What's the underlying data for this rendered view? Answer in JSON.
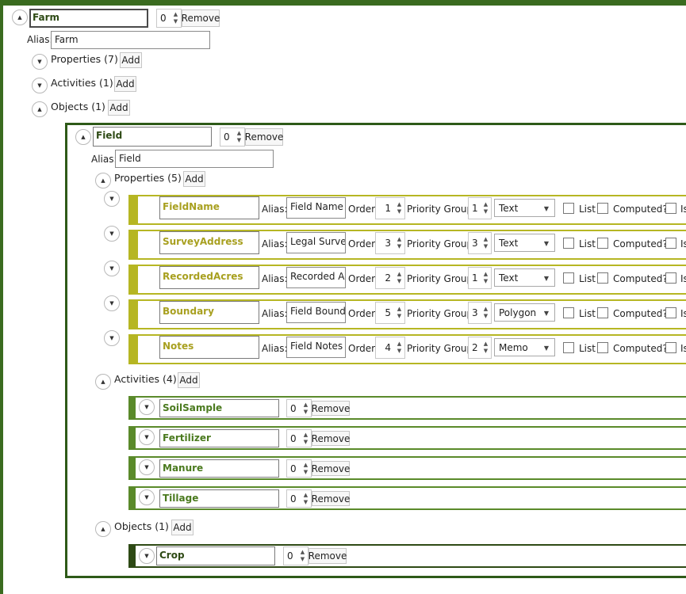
{
  "farm": {
    "name": "Farm",
    "order": "0",
    "remove_label": "Remove",
    "alias_label": "Alias:",
    "alias": "Farm",
    "sections": {
      "properties": "Properties (7)",
      "activities": "Activities (1)",
      "objects": "Objects (1)"
    },
    "add_label": "Add"
  },
  "field": {
    "name": "Field",
    "order": "0",
    "remove_label": "Remove",
    "alias_label": "Alias:",
    "alias": "Field",
    "properties_label": "Properties (5)",
    "activities_label": "Activities (4)",
    "objects_label": "Objects (1)",
    "add_label": "Add",
    "property_labels": {
      "alias": "Alias:",
      "order": "Order:",
      "priority_group": "Priority Group:",
      "list": "List",
      "computed": "Computed?",
      "is_truncated": "Is"
    },
    "properties": [
      {
        "name": "FieldName",
        "alias": "Field Name",
        "order": "1",
        "priority_group": "1",
        "type": "Text"
      },
      {
        "name": "SurveyAddress",
        "alias": "Legal Survey",
        "order": "3",
        "priority_group": "3",
        "type": "Text"
      },
      {
        "name": "RecordedAcres",
        "alias": "Recorded Ac",
        "order": "2",
        "priority_group": "1",
        "type": "Text"
      },
      {
        "name": "Boundary",
        "alias": "Field Bounda",
        "order": "5",
        "priority_group": "3",
        "type": "Polygon"
      },
      {
        "name": "Notes",
        "alias": "Field Notes",
        "order": "4",
        "priority_group": "2",
        "type": "Memo"
      }
    ],
    "activities": [
      {
        "name": "SoilSample",
        "order": "0",
        "remove_label": "Remove"
      },
      {
        "name": "Fertilizer",
        "order": "0",
        "remove_label": "Remove"
      },
      {
        "name": "Manure",
        "order": "0",
        "remove_label": "Remove"
      },
      {
        "name": "Tillage",
        "order": "0",
        "remove_label": "Remove"
      }
    ],
    "objects": [
      {
        "name": "Crop",
        "order": "0",
        "remove_label": "Remove"
      }
    ]
  },
  "colors": {
    "farm_border": "#3a6b1f",
    "field_border": "#2e5a18",
    "property_accent": "#b6b623",
    "activity_accent": "#5a8a2a",
    "object_accent": "#2e4a15"
  },
  "icons": {
    "expanded": "chevron-up-icon",
    "collapsed": "chevron-down-icon",
    "spinner": "spinner-arrows-icon",
    "dropdown": "dropdown-caret-icon"
  }
}
